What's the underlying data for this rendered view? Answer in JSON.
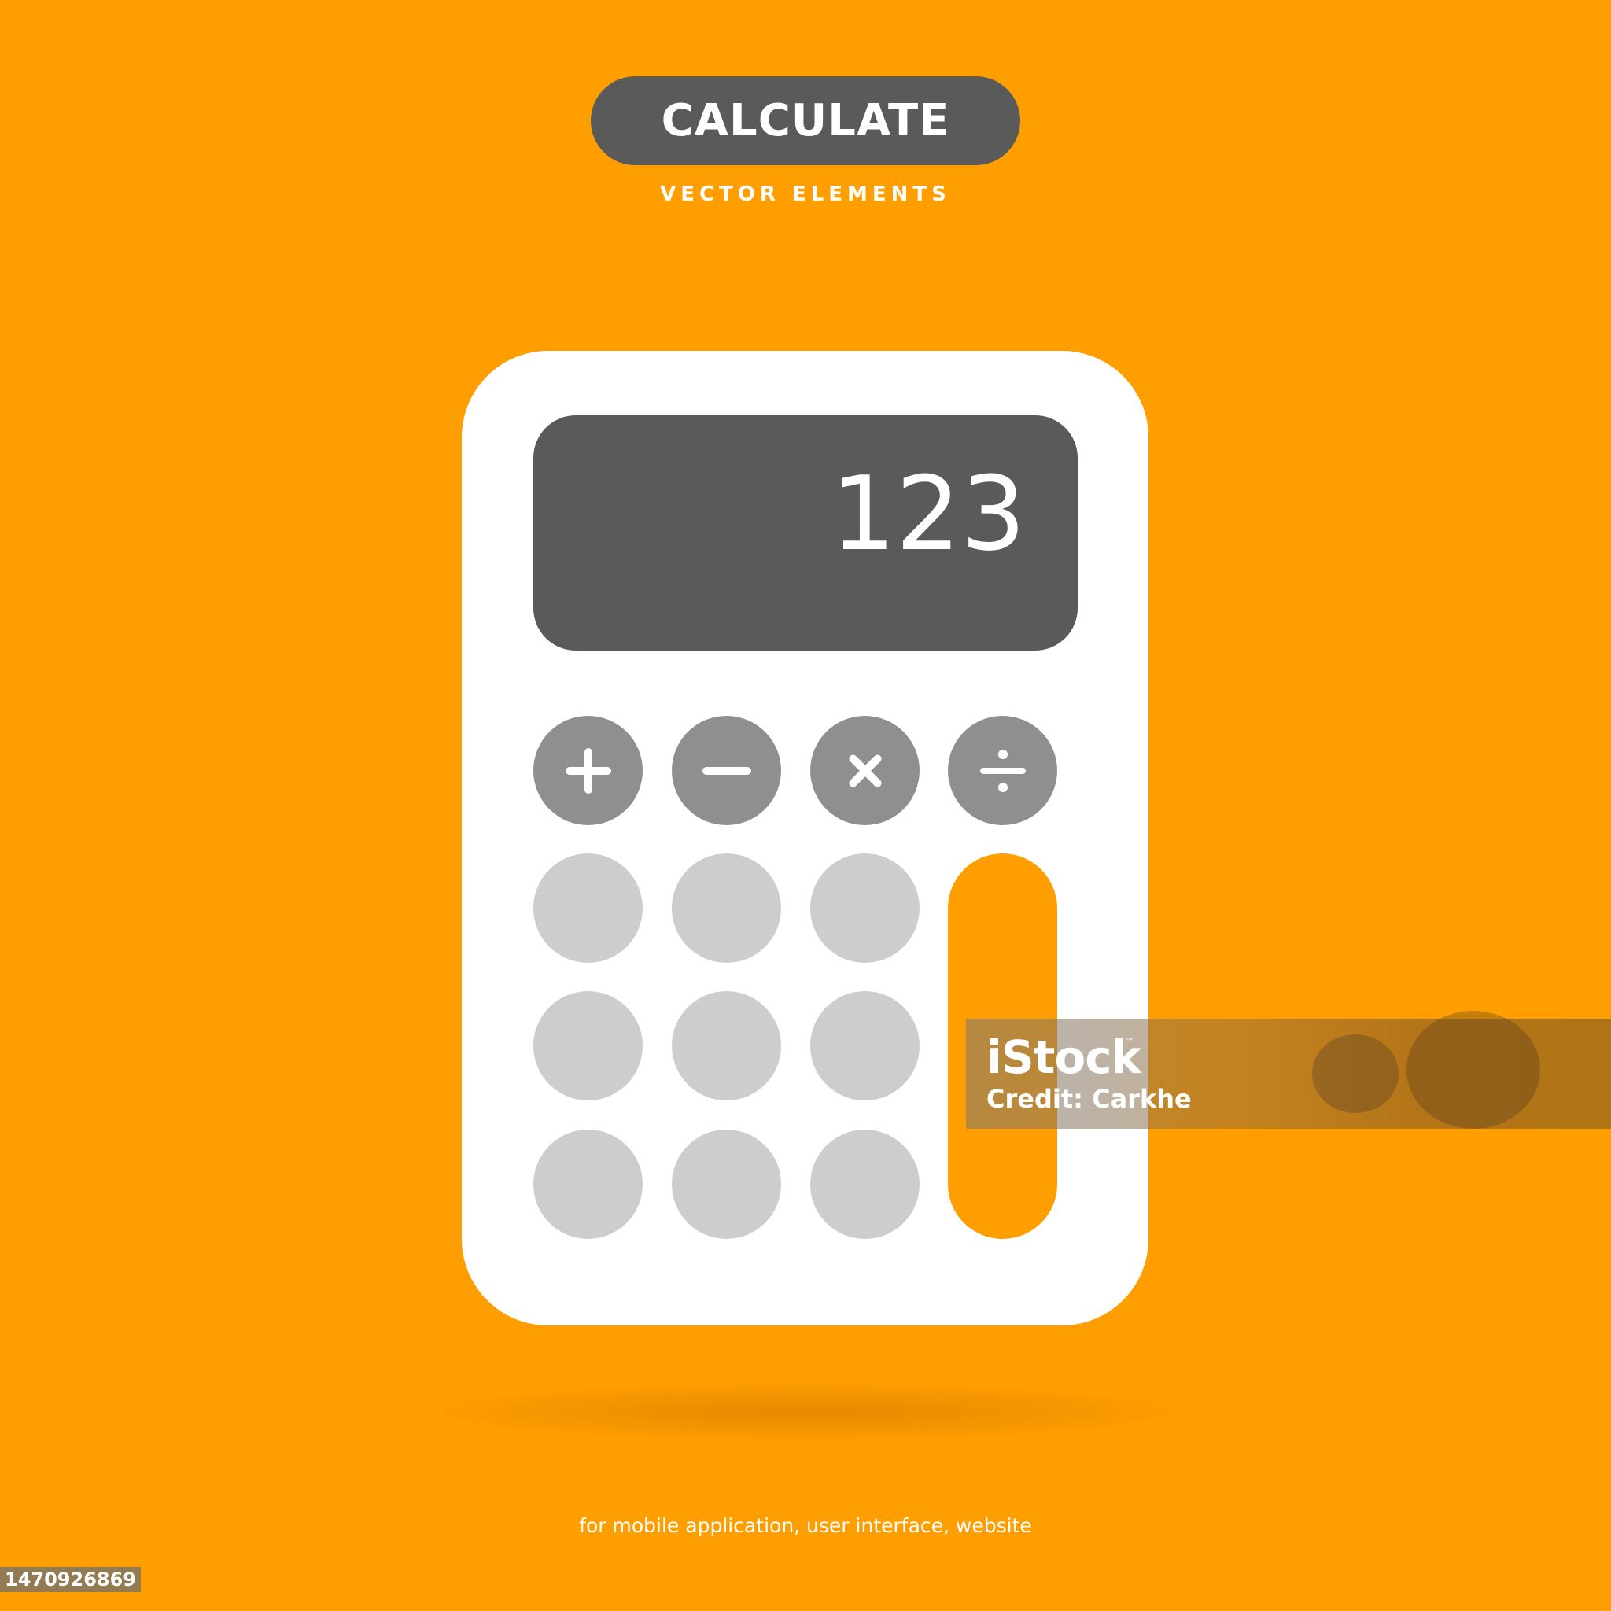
{
  "header": {
    "title": "CALCULATE",
    "subtitle": "VECTOR ELEMENTS"
  },
  "calculator": {
    "display_value": "123",
    "operator_keys": [
      {
        "label": "+",
        "icon": "plus-icon"
      },
      {
        "label": "−",
        "icon": "minus-icon"
      },
      {
        "label": "×",
        "icon": "multiply-icon"
      },
      {
        "label": "÷",
        "icon": "divide-icon"
      }
    ]
  },
  "caption": "for mobile application, user interface, website",
  "watermark": {
    "logo": "iStock",
    "trademark": "™",
    "credit": "Credit: Carkhe"
  },
  "image_id": "1470926869",
  "colors": {
    "background": "#FF9E00",
    "dark_gray": "#5A5A5A",
    "operator_gray": "#8F8F8F",
    "key_light_gray": "#CDCDCD",
    "white": "#FFFFFF"
  }
}
